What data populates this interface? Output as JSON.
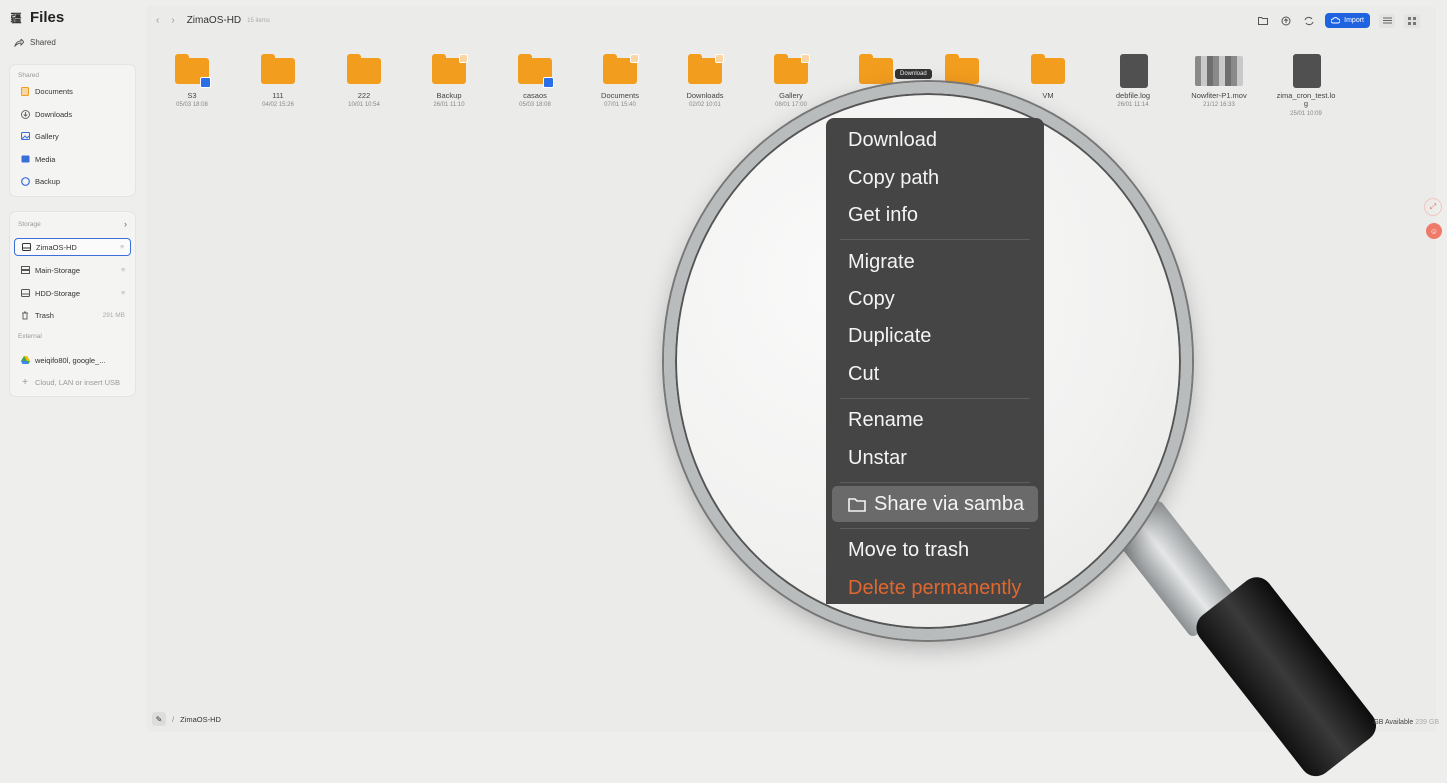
{
  "app": {
    "logo_glyph": "疆",
    "title": "Files"
  },
  "sidebar": {
    "shared_label": "Shared",
    "shared_section": {
      "header": "Shared",
      "items": [
        {
          "label": "Documents",
          "icon": "document-icon"
        },
        {
          "label": "Downloads",
          "icon": "download-icon"
        },
        {
          "label": "Gallery",
          "icon": "image-icon"
        },
        {
          "label": "Media",
          "icon": "media-icon"
        },
        {
          "label": "Backup",
          "icon": "backup-icon"
        }
      ]
    },
    "storage_section": {
      "header": "Storage",
      "items": [
        {
          "label": "ZimaOS-HD",
          "meta": "",
          "active": true
        },
        {
          "label": "Main-Storage",
          "meta": ""
        },
        {
          "label": "HDD-Storage",
          "meta": ""
        },
        {
          "label": "Trash",
          "meta": "291 MB"
        }
      ]
    },
    "external_section": {
      "header": "External",
      "items": [
        {
          "label": "weiqifo80l, google_..."
        },
        {
          "label": "Cloud, LAN or insert USB"
        }
      ]
    }
  },
  "toolbar": {
    "breadcrumb": "ZimaOS-HD",
    "item_count": "15 items",
    "import_label": "Import"
  },
  "files": [
    {
      "name": "S3",
      "date": "05/03 18:08",
      "kind": "folder",
      "badge": "blue"
    },
    {
      "name": "111",
      "date": "04/02 15:26",
      "kind": "folder",
      "badge": ""
    },
    {
      "name": "222",
      "date": "10/01 10:54",
      "kind": "folder",
      "badge": ""
    },
    {
      "name": "Backup",
      "date": "26/01 11:10",
      "kind": "folder",
      "badge": "dot"
    },
    {
      "name": "casaos",
      "date": "05/03 18:08",
      "kind": "folder",
      "badge": "blue"
    },
    {
      "name": "Documents",
      "date": "07/01 15:40",
      "kind": "folder",
      "badge": "dot"
    },
    {
      "name": "Downloads",
      "date": "02/02 10:01",
      "kind": "folder",
      "badge": "dot"
    },
    {
      "name": "Gallery",
      "date": "08/01 17:00",
      "kind": "folder",
      "badge": "dot"
    },
    {
      "name": "",
      "date": "",
      "kind": "folder",
      "badge": ""
    },
    {
      "name": "",
      "date": "",
      "kind": "folder",
      "badge": ""
    },
    {
      "name": "VM",
      "date": "",
      "kind": "folder",
      "badge": ""
    },
    {
      "name": "debfile.log",
      "date": "26/01 11:14",
      "kind": "doc",
      "badge": ""
    },
    {
      "name": "Nowfiter-P1.mov",
      "date": "21/12 16:33",
      "kind": "image",
      "badge": ""
    },
    {
      "name": "zima_cron_test.lo\ng",
      "date": "25/01 10:09",
      "kind": "doc",
      "badge": ""
    }
  ],
  "tooltip": "Download",
  "context_menu": {
    "items": [
      {
        "label": "Download"
      },
      {
        "label": "Copy path"
      },
      {
        "label": "Get info"
      },
      {
        "label": "Migrate"
      },
      {
        "label": "Copy"
      },
      {
        "label": "Duplicate"
      },
      {
        "label": "Cut"
      },
      {
        "label": "Rename"
      },
      {
        "label": "Unstar"
      },
      {
        "label": "Share via samba",
        "highlighted": true
      },
      {
        "label": "Move to trash"
      },
      {
        "label": "Delete permanently",
        "danger": true
      }
    ],
    "danger_color": "#e0672e"
  },
  "statusbar": {
    "path": "ZimaOS-HD",
    "available_label": "GB Available",
    "available_value": "239 GB"
  },
  "colors": {
    "accent": "#1f63e0",
    "folder": "#f39d1e"
  }
}
